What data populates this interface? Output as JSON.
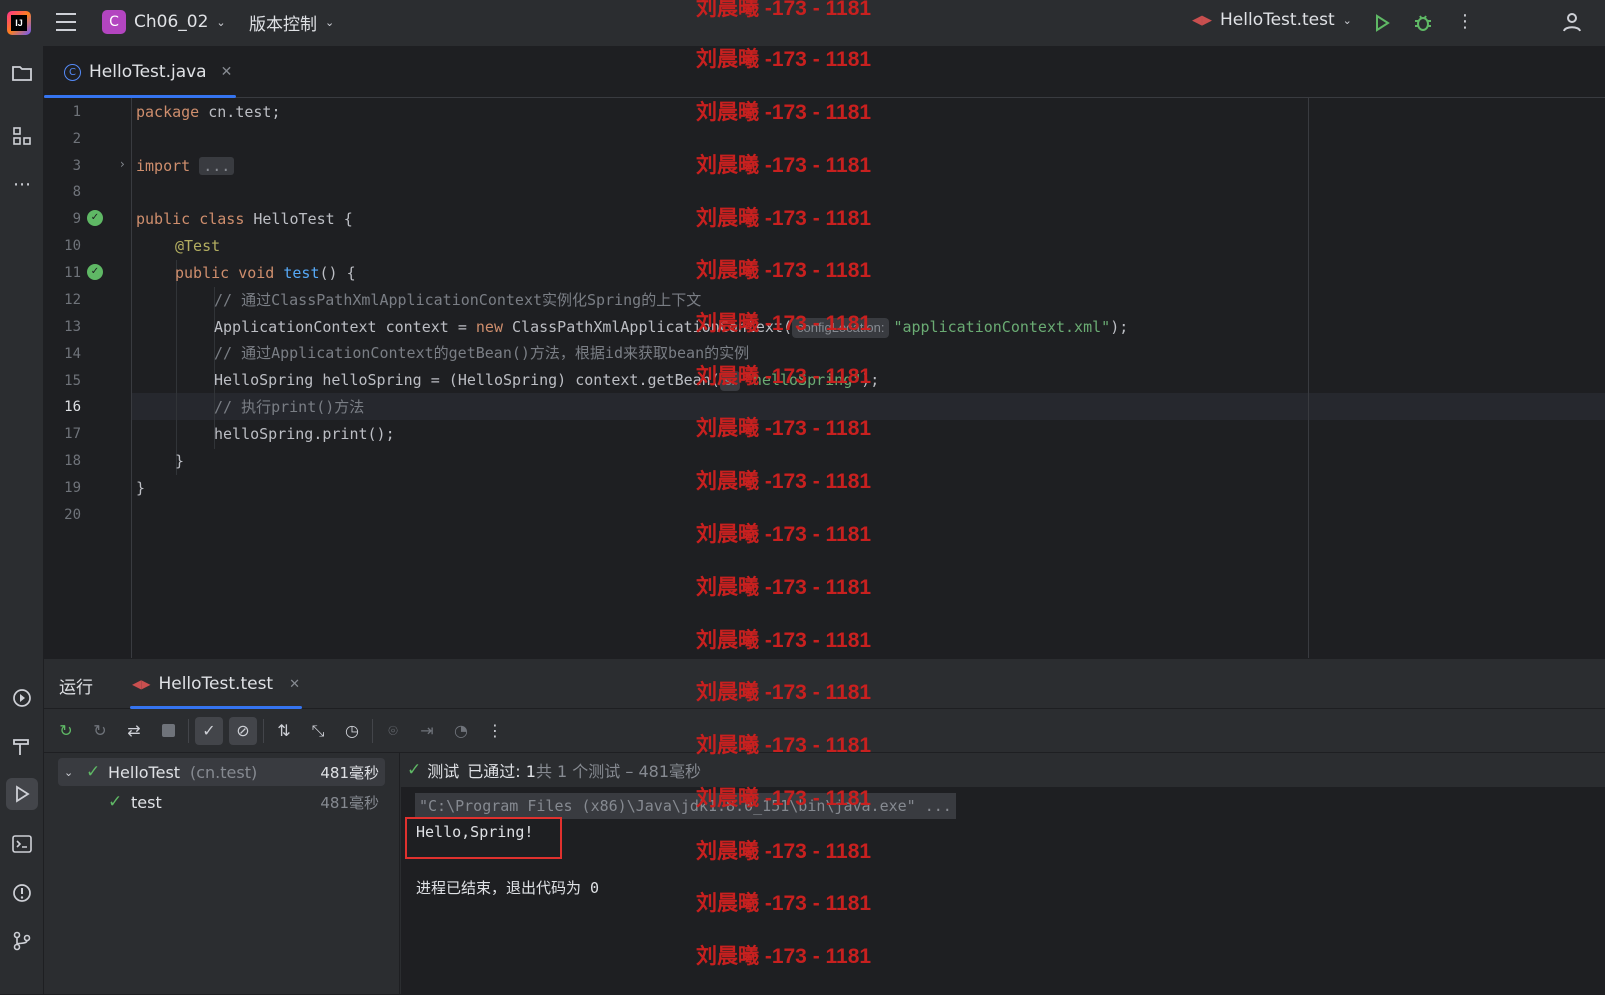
{
  "titlebar": {
    "project_badge": "C",
    "project_name": "Ch06_02",
    "vcs_label": "版本控制",
    "run_config": "HelloTest.test"
  },
  "editor": {
    "tab_file": "HelloTest.java",
    "current_line": 16,
    "lines": [
      {
        "no": "1"
      },
      {
        "no": "2"
      },
      {
        "no": "3"
      },
      {
        "no": "8"
      },
      {
        "no": "9"
      },
      {
        "no": "10"
      },
      {
        "no": "11"
      },
      {
        "no": "12"
      },
      {
        "no": "13"
      },
      {
        "no": "14"
      },
      {
        "no": "15"
      },
      {
        "no": "16"
      },
      {
        "no": "17"
      },
      {
        "no": "18"
      },
      {
        "no": "19"
      },
      {
        "no": "20"
      }
    ],
    "code": {
      "l1_kw": "package",
      "l1_rest": " cn.test;",
      "l3_kw": "import",
      "l3_fold": "...",
      "l9_kw": "public class",
      "l9_rest": " HelloTest {",
      "l10_ann": "@Test",
      "l11_kw": "public void",
      "l11_fn": "test",
      "l11_rest": "() {",
      "l12_cm": "// 通过ClassPathXmlApplicationContext实例化Spring的上下文",
      "l13_a": "ApplicationContext context = ",
      "l13_kw": "new",
      "l13_b": " ClassPathXmlApplicationContext(",
      "l13_hint": "configLocation:",
      "l13_str": "\"applicationContext.xml\"",
      "l13_end": ");",
      "l14_cm": "// 通过ApplicationContext的getBean()方法，根据id来获取bean的实例",
      "l15_a": "HelloSpring helloSpring = (HelloSpring) context.getBean(",
      "l15_hint": "s:",
      "l15_str": "\"helloSpring\"",
      "l15_end": ");",
      "l16_cm": "// 执行print()方法",
      "l17": "helloSpring.print();",
      "l18": "}",
      "l19": "}"
    }
  },
  "run_panel": {
    "tab_run": "运行",
    "tab_config": "HelloTest.test",
    "tree": {
      "root_label": "HelloTest",
      "root_pkg": "(cn.test)",
      "root_time": "481毫秒",
      "child_label": "test",
      "child_time": "481毫秒"
    },
    "status": {
      "prefix": "测试",
      "passed": "已通过: 1",
      "summary": "共 1 个测试 – 481毫秒"
    },
    "console": {
      "cmd": "\"C:\\Program Files (x86)\\Java\\jdk1.8.0_151\\bin\\java.exe\" ...",
      "output": "Hello,Spring!",
      "exit": "进程已结束，退出代码为 0"
    }
  },
  "watermark": "刘晨曦 -173 - 1181",
  "colors": {
    "accent": "#3574f0",
    "pass": "#5fb865",
    "keyword": "#cf8e6d",
    "string": "#6aab73",
    "annotation": "#b3ae60",
    "comment": "#7a7e85",
    "watermark": "#c8201f",
    "highlight_box": "#e0312e"
  }
}
